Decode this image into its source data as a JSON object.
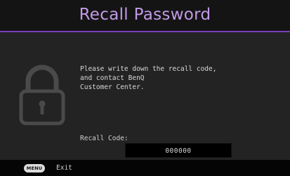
{
  "dialog": {
    "title": "Recall Password",
    "message": "Please write down the recall code,\nand contact BenQ\nCustomer Center.",
    "recall_label": "Recall Code:",
    "recall_code": "000000",
    "lock_icon": "padlock-icon"
  },
  "footer": {
    "menu_key_label": "MENU",
    "exit_label": "Exit"
  },
  "colors": {
    "accent": "#7a3fbf",
    "title_text": "#c39ae6",
    "background": "#232323"
  }
}
